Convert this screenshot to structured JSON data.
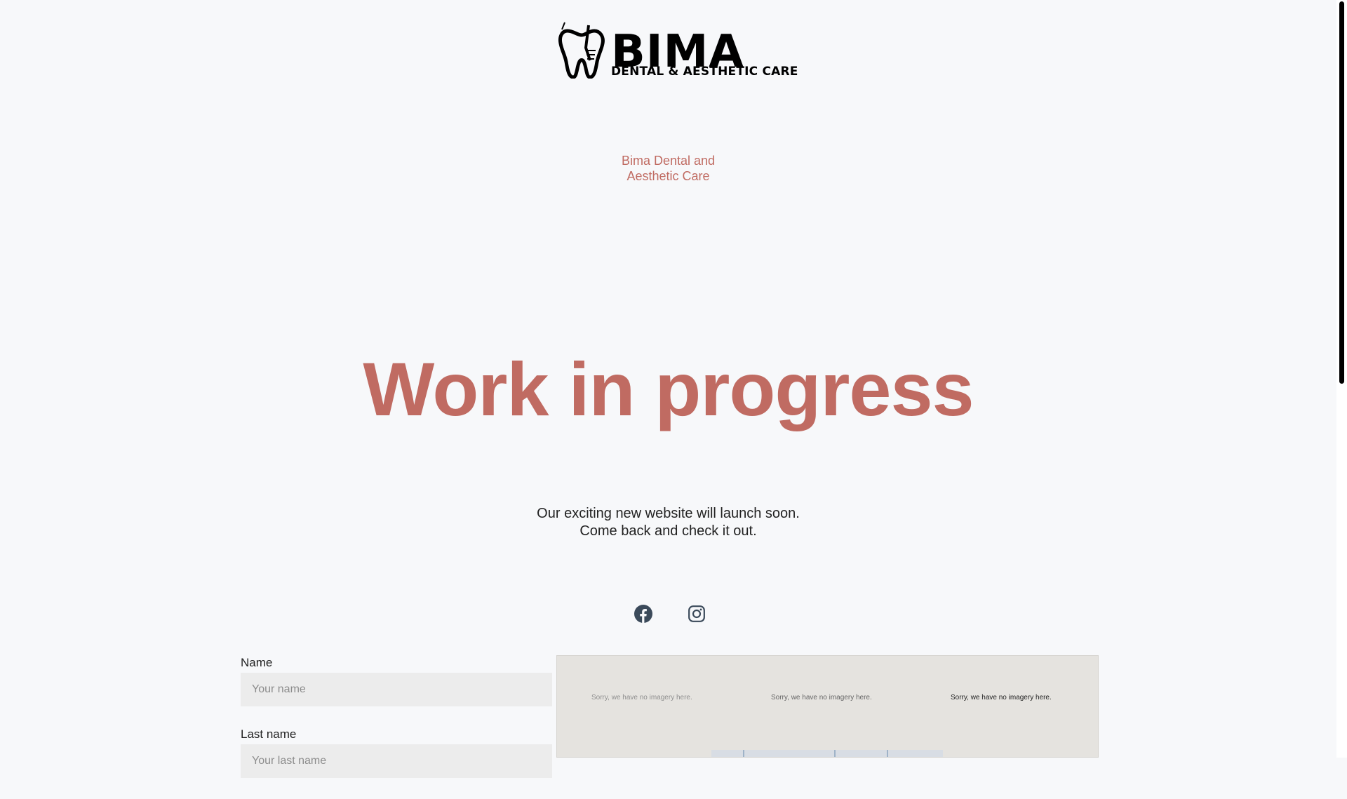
{
  "logo": {
    "brand": "BIMA",
    "tagline": "DENTAL & AESTHETIC CARE"
  },
  "subtitle": {
    "line1": "Bima Dental and",
    "line2": "Aesthetic Care"
  },
  "headline": "Work in progress",
  "lead": {
    "line1": "Our exciting new website will launch soon.",
    "line2": "Come back and check it out."
  },
  "social": {
    "icons": [
      "facebook-icon",
      "instagram-icon"
    ]
  },
  "form": {
    "name_label": "Name",
    "name_placeholder": "Your name",
    "last_name_label": "Last name",
    "last_name_placeholder": "Your last name"
  },
  "map": {
    "tile_messages": [
      "Sorry, we have no imagery here.",
      "Sorry, we have no imagery here.",
      "Sorry, we have no imagery here."
    ]
  },
  "colors": {
    "accent": "#c06b62",
    "background": "#f7f8fa",
    "text": "#222222",
    "input_bg": "#ececec"
  }
}
